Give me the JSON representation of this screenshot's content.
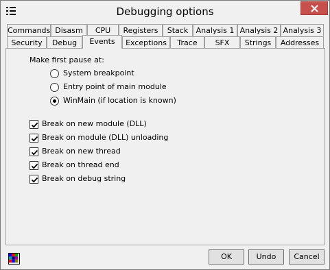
{
  "window": {
    "title": "Debugging options"
  },
  "tabs": {
    "row1": [
      "Commands",
      "Disasm",
      "CPU",
      "Registers",
      "Stack",
      "Analysis 1",
      "Analysis 2",
      "Analysis 3"
    ],
    "row2": [
      "Security",
      "Debug",
      "Events",
      "Exceptions",
      "Trace",
      "SFX",
      "Strings",
      "Addresses"
    ],
    "active": "Events"
  },
  "events": {
    "first_pause_label": "Make first pause at:",
    "radio_options": [
      "System breakpoint",
      "Entry point of main module",
      "WinMain (if location is known)"
    ],
    "radio_selected": "WinMain (if location is known)",
    "checkboxes": [
      {
        "label": "Break on new module (DLL)",
        "checked": true
      },
      {
        "label": "Break on module (DLL) unloading",
        "checked": true
      },
      {
        "label": "Break on new thread",
        "checked": true
      },
      {
        "label": "Break on thread end",
        "checked": true
      },
      {
        "label": "Break on debug string",
        "checked": true
      }
    ]
  },
  "buttons": {
    "ok": "OK",
    "undo": "Undo",
    "cancel": "Cancel"
  },
  "colors": {
    "close": "#c7504c",
    "panel": "#f0f0f0",
    "border": "#a0a0a0"
  }
}
